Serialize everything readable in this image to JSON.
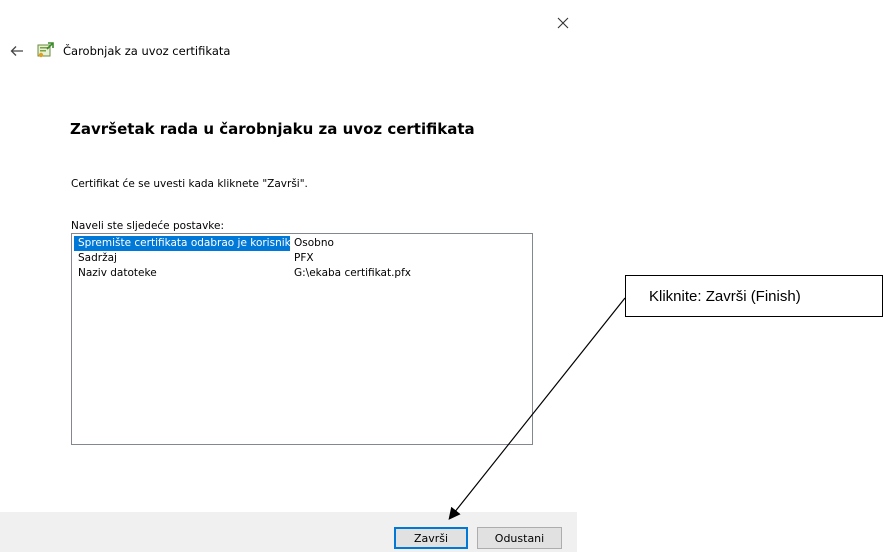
{
  "window": {
    "title": "Čarobnjak za uvoz certifikata",
    "close_icon": "close-icon",
    "back_icon": "back-arrow-icon",
    "wizard_icon": "certificate-wizard-icon"
  },
  "content": {
    "heading": "Završetak rada u čarobnjaku za uvoz certifikata",
    "info": "Certifikat će se uvesti kada kliknete \"Završi\".",
    "settings_label": "Naveli ste sljedeće postavke:",
    "settings": [
      {
        "name": "Spremište certifikata odabrao je korisnik",
        "value": "Osobno",
        "selected": true
      },
      {
        "name": "Sadržaj",
        "value": "PFX",
        "selected": false
      },
      {
        "name": "Naziv datoteke",
        "value": "G:\\ekaba certifikat.pfx",
        "selected": false
      }
    ]
  },
  "footer": {
    "finish_label": "Završi",
    "cancel_label": "Odustani"
  },
  "annotation": {
    "callout_text": "Kliknite: Završi (Finish)"
  },
  "colors": {
    "selection": "#0078d7",
    "footer_bg": "#f0f0f0",
    "button_bg": "#e1e1e1",
    "default_button_border": "#0078d7"
  }
}
